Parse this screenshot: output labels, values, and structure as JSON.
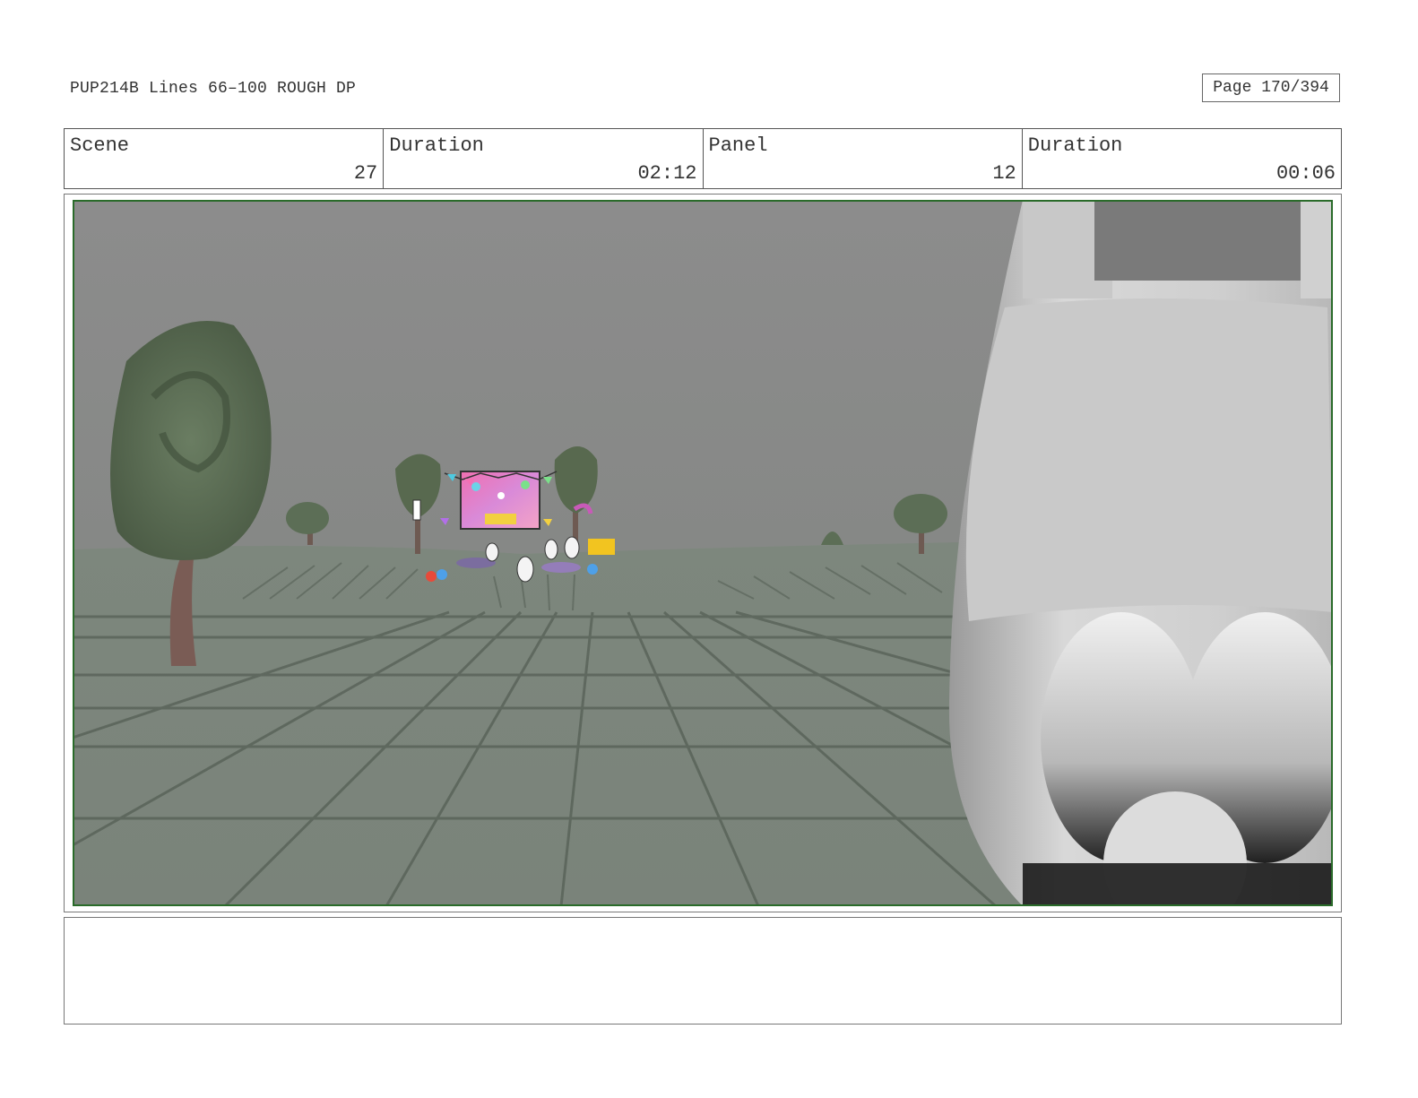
{
  "header": {
    "doc_title": "PUP214B Lines 66–100 ROUGH DP",
    "page_label": "Page 170/394"
  },
  "info": {
    "scene_label": "Scene",
    "scene_value": "27",
    "scene_duration_label": "Duration",
    "scene_duration_value": "02:12",
    "panel_label": "Panel",
    "panel_value": "12",
    "panel_duration_label": "Duration",
    "panel_duration_value": "00:06"
  },
  "notes": {
    "text": ""
  },
  "colors": {
    "frame_border": "#2a6b2a",
    "sky": "#8a8a8a",
    "ground": "#7b857b",
    "tree": "#56684f"
  }
}
